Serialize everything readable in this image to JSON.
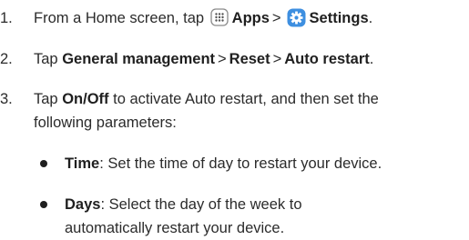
{
  "steps": [
    {
      "number": "1.",
      "prefix": "From a Home screen, tap",
      "apps_label": "Apps",
      "apps_icon": "apps-grid-icon",
      "separator": ">",
      "settings_label": "Settings",
      "settings_icon": "settings-gear-icon",
      "suffix": "."
    },
    {
      "number": "2.",
      "prefix": "Tap",
      "item1": "General management",
      "sep1": ">",
      "item2": "Reset",
      "sep2": ">",
      "item3": "Auto restart",
      "suffix": "."
    },
    {
      "number": "3.",
      "prefix": "Tap",
      "onoff": "On/Off",
      "rest": "to activate Auto restart, and then set the following parameters:"
    }
  ],
  "bullets": [
    {
      "term": "Time",
      "text": ": Set the time of day to restart your device."
    },
    {
      "term": "Days",
      "text": ": Select the day of the week to automatically restart your device."
    }
  ],
  "colors": {
    "text": "#2b2b2b",
    "settings_icon_bg": "#3e8fe0",
    "apps_icon_border": "#777777"
  }
}
